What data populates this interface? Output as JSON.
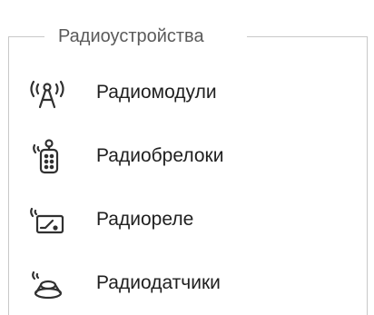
{
  "section": {
    "title": "Радиоустройства"
  },
  "items": [
    {
      "label": "Радиомодули",
      "icon": "radio-antenna-icon"
    },
    {
      "label": "Радиобрелоки",
      "icon": "key-fob-icon"
    },
    {
      "label": "Радиореле",
      "icon": "radio-relay-icon"
    },
    {
      "label": "Радиодатчики",
      "icon": "radio-sensor-icon"
    }
  ],
  "colors": {
    "border": "#c8c8c8",
    "title_text": "#5a5a5a",
    "item_text": "#202020",
    "icon_stroke": "#303030"
  }
}
